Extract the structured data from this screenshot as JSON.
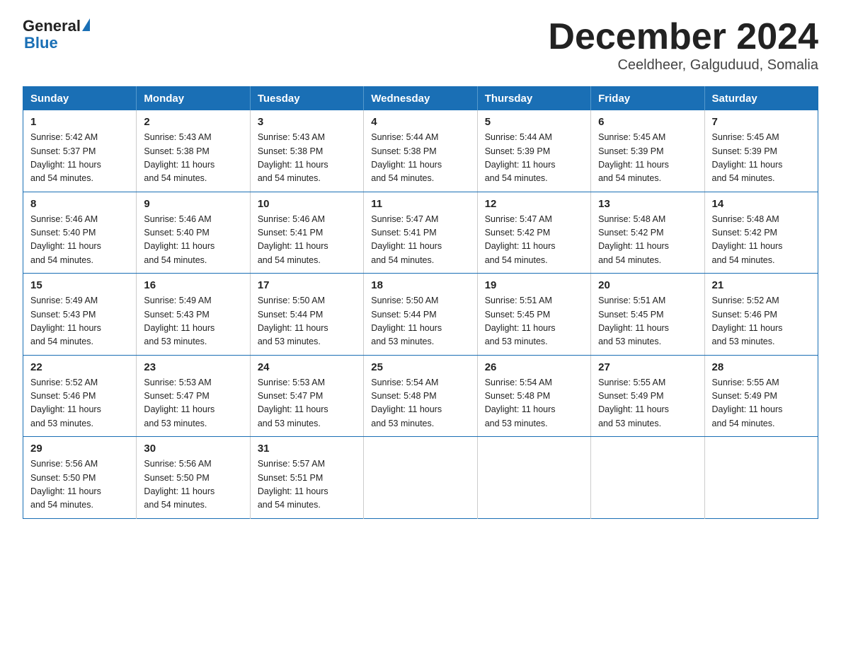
{
  "header": {
    "logo_general": "General",
    "logo_blue": "Blue",
    "title": "December 2024",
    "subtitle": "Ceeldheer, Galguduud, Somalia"
  },
  "days_of_week": [
    "Sunday",
    "Monday",
    "Tuesday",
    "Wednesday",
    "Thursday",
    "Friday",
    "Saturday"
  ],
  "weeks": [
    [
      {
        "day": "1",
        "sunrise": "5:42 AM",
        "sunset": "5:37 PM",
        "daylight": "11 hours and 54 minutes."
      },
      {
        "day": "2",
        "sunrise": "5:43 AM",
        "sunset": "5:38 PM",
        "daylight": "11 hours and 54 minutes."
      },
      {
        "day": "3",
        "sunrise": "5:43 AM",
        "sunset": "5:38 PM",
        "daylight": "11 hours and 54 minutes."
      },
      {
        "day": "4",
        "sunrise": "5:44 AM",
        "sunset": "5:38 PM",
        "daylight": "11 hours and 54 minutes."
      },
      {
        "day": "5",
        "sunrise": "5:44 AM",
        "sunset": "5:39 PM",
        "daylight": "11 hours and 54 minutes."
      },
      {
        "day": "6",
        "sunrise": "5:45 AM",
        "sunset": "5:39 PM",
        "daylight": "11 hours and 54 minutes."
      },
      {
        "day": "7",
        "sunrise": "5:45 AM",
        "sunset": "5:39 PM",
        "daylight": "11 hours and 54 minutes."
      }
    ],
    [
      {
        "day": "8",
        "sunrise": "5:46 AM",
        "sunset": "5:40 PM",
        "daylight": "11 hours and 54 minutes."
      },
      {
        "day": "9",
        "sunrise": "5:46 AM",
        "sunset": "5:40 PM",
        "daylight": "11 hours and 54 minutes."
      },
      {
        "day": "10",
        "sunrise": "5:46 AM",
        "sunset": "5:41 PM",
        "daylight": "11 hours and 54 minutes."
      },
      {
        "day": "11",
        "sunrise": "5:47 AM",
        "sunset": "5:41 PM",
        "daylight": "11 hours and 54 minutes."
      },
      {
        "day": "12",
        "sunrise": "5:47 AM",
        "sunset": "5:42 PM",
        "daylight": "11 hours and 54 minutes."
      },
      {
        "day": "13",
        "sunrise": "5:48 AM",
        "sunset": "5:42 PM",
        "daylight": "11 hours and 54 minutes."
      },
      {
        "day": "14",
        "sunrise": "5:48 AM",
        "sunset": "5:42 PM",
        "daylight": "11 hours and 54 minutes."
      }
    ],
    [
      {
        "day": "15",
        "sunrise": "5:49 AM",
        "sunset": "5:43 PM",
        "daylight": "11 hours and 54 minutes."
      },
      {
        "day": "16",
        "sunrise": "5:49 AM",
        "sunset": "5:43 PM",
        "daylight": "11 hours and 53 minutes."
      },
      {
        "day": "17",
        "sunrise": "5:50 AM",
        "sunset": "5:44 PM",
        "daylight": "11 hours and 53 minutes."
      },
      {
        "day": "18",
        "sunrise": "5:50 AM",
        "sunset": "5:44 PM",
        "daylight": "11 hours and 53 minutes."
      },
      {
        "day": "19",
        "sunrise": "5:51 AM",
        "sunset": "5:45 PM",
        "daylight": "11 hours and 53 minutes."
      },
      {
        "day": "20",
        "sunrise": "5:51 AM",
        "sunset": "5:45 PM",
        "daylight": "11 hours and 53 minutes."
      },
      {
        "day": "21",
        "sunrise": "5:52 AM",
        "sunset": "5:46 PM",
        "daylight": "11 hours and 53 minutes."
      }
    ],
    [
      {
        "day": "22",
        "sunrise": "5:52 AM",
        "sunset": "5:46 PM",
        "daylight": "11 hours and 53 minutes."
      },
      {
        "day": "23",
        "sunrise": "5:53 AM",
        "sunset": "5:47 PM",
        "daylight": "11 hours and 53 minutes."
      },
      {
        "day": "24",
        "sunrise": "5:53 AM",
        "sunset": "5:47 PM",
        "daylight": "11 hours and 53 minutes."
      },
      {
        "day": "25",
        "sunrise": "5:54 AM",
        "sunset": "5:48 PM",
        "daylight": "11 hours and 53 minutes."
      },
      {
        "day": "26",
        "sunrise": "5:54 AM",
        "sunset": "5:48 PM",
        "daylight": "11 hours and 53 minutes."
      },
      {
        "day": "27",
        "sunrise": "5:55 AM",
        "sunset": "5:49 PM",
        "daylight": "11 hours and 53 minutes."
      },
      {
        "day": "28",
        "sunrise": "5:55 AM",
        "sunset": "5:49 PM",
        "daylight": "11 hours and 54 minutes."
      }
    ],
    [
      {
        "day": "29",
        "sunrise": "5:56 AM",
        "sunset": "5:50 PM",
        "daylight": "11 hours and 54 minutes."
      },
      {
        "day": "30",
        "sunrise": "5:56 AM",
        "sunset": "5:50 PM",
        "daylight": "11 hours and 54 minutes."
      },
      {
        "day": "31",
        "sunrise": "5:57 AM",
        "sunset": "5:51 PM",
        "daylight": "11 hours and 54 minutes."
      },
      null,
      null,
      null,
      null
    ]
  ],
  "labels": {
    "sunrise": "Sunrise:",
    "sunset": "Sunset:",
    "daylight": "Daylight:"
  }
}
